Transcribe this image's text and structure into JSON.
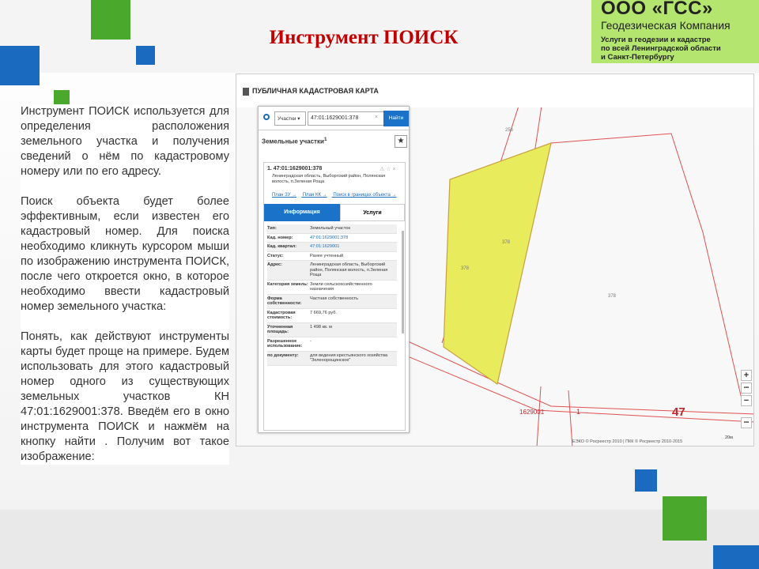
{
  "slide": {
    "title": "Инструмент ПОИСК",
    "paragraphs": [
      "Инструмент ПОИСК используется для определения расположения земельного участка и получения сведений о нём по кадастровому номеру или по его адресу.",
      "Поиск объекта будет более эффективным, если известен его кадастровый номер. Для поиска необходимо кликнуть курсором мыши по изображению инструмента ПОИСК, после чего откроется окно, в которое необходимо ввести кадастровый номер земельного участка:",
      "Понять, как действуют инструменты карты будет проще на примере. Будем использовать для этого кадастровый номер одного из существующих земельных участков КН 47:01:1629001:378. Введём его в окно инструмента ПОИСК и нажмём на кнопку найти . Получим вот такое изображение:"
    ]
  },
  "logo": {
    "name": "ООО «ГСС»",
    "company": "Геодезическая Компания",
    "tagline_1": "Услуги в геодезии и кадастре",
    "tagline_2": "по всей Ленинградской области",
    "tagline_3": "и Санкт-Петербургу"
  },
  "colors": {
    "title": "#c00000",
    "accent_blue": "#1a73c8",
    "parcel_fill": "#e8ec5c",
    "boundary": "#e05050"
  },
  "map": {
    "header": "ПУБЛИЧНАЯ КАДАСТРОВАЯ КАРТА",
    "labels": {
      "region_left": "47",
      "region_right": "47",
      "block": "1629001",
      "block_short": "1",
      "parcel_a": "378",
      "parcel_b": "378",
      "parcel_c": "378",
      "parcel_top": "256"
    },
    "copyright": "ЕЭКО © Росреестр 2010 | ПКК © Росреестр 2010-2015",
    "scale": "20м",
    "zoom_in": "+",
    "zoom_out": "−",
    "more": "•••"
  },
  "panel": {
    "search_type": "Участки ▾",
    "search_value": "47:01:1629001:378",
    "search_clear": "×",
    "search_button": "Найти",
    "title": "Земельные участки",
    "title_sup": "1",
    "star": "★",
    "result_number": "1.",
    "result_cadnum": "47:01:1629001:378",
    "result_tools": "⚠ ☆ ×",
    "result_address": "Ленинградская область, Выборгский район, Полянская волость, п.Зеленая Роща",
    "links": [
      "План ЗУ →",
      "План КК →",
      "Поиск в границах объекта →"
    ],
    "tab_info": "Информация",
    "tab_services": "Услуги",
    "rows": [
      {
        "k": "Тип:",
        "v": "Земельный участок"
      },
      {
        "k": "Кад. номер:",
        "v": "47:01:1629001:378"
      },
      {
        "k": "Кад. квартал:",
        "v": "47:01:1629001"
      },
      {
        "k": "Статус:",
        "v": "Ранее учтенный"
      },
      {
        "k": "Адрес:",
        "v": "Ленинградская область, Выборгский район, Полянская волость, п.Зеленая Роща"
      },
      {
        "k": "Категория земель:",
        "v": "Земли сельскохозяйственного назначения"
      },
      {
        "k": "Форма собственности:",
        "v": "Частная собственность"
      },
      {
        "k": "Кадастровая стоимость:",
        "v": "7 669,76 руб."
      },
      {
        "k": "Уточненная площадь:",
        "v": "1 498 кв. м"
      },
      {
        "k": "Разрешенное использование:",
        "v": "-"
      },
      {
        "k": "по документу:",
        "v": "для ведения крестьянского хозяйства \"Зеленорощинское\""
      }
    ]
  }
}
